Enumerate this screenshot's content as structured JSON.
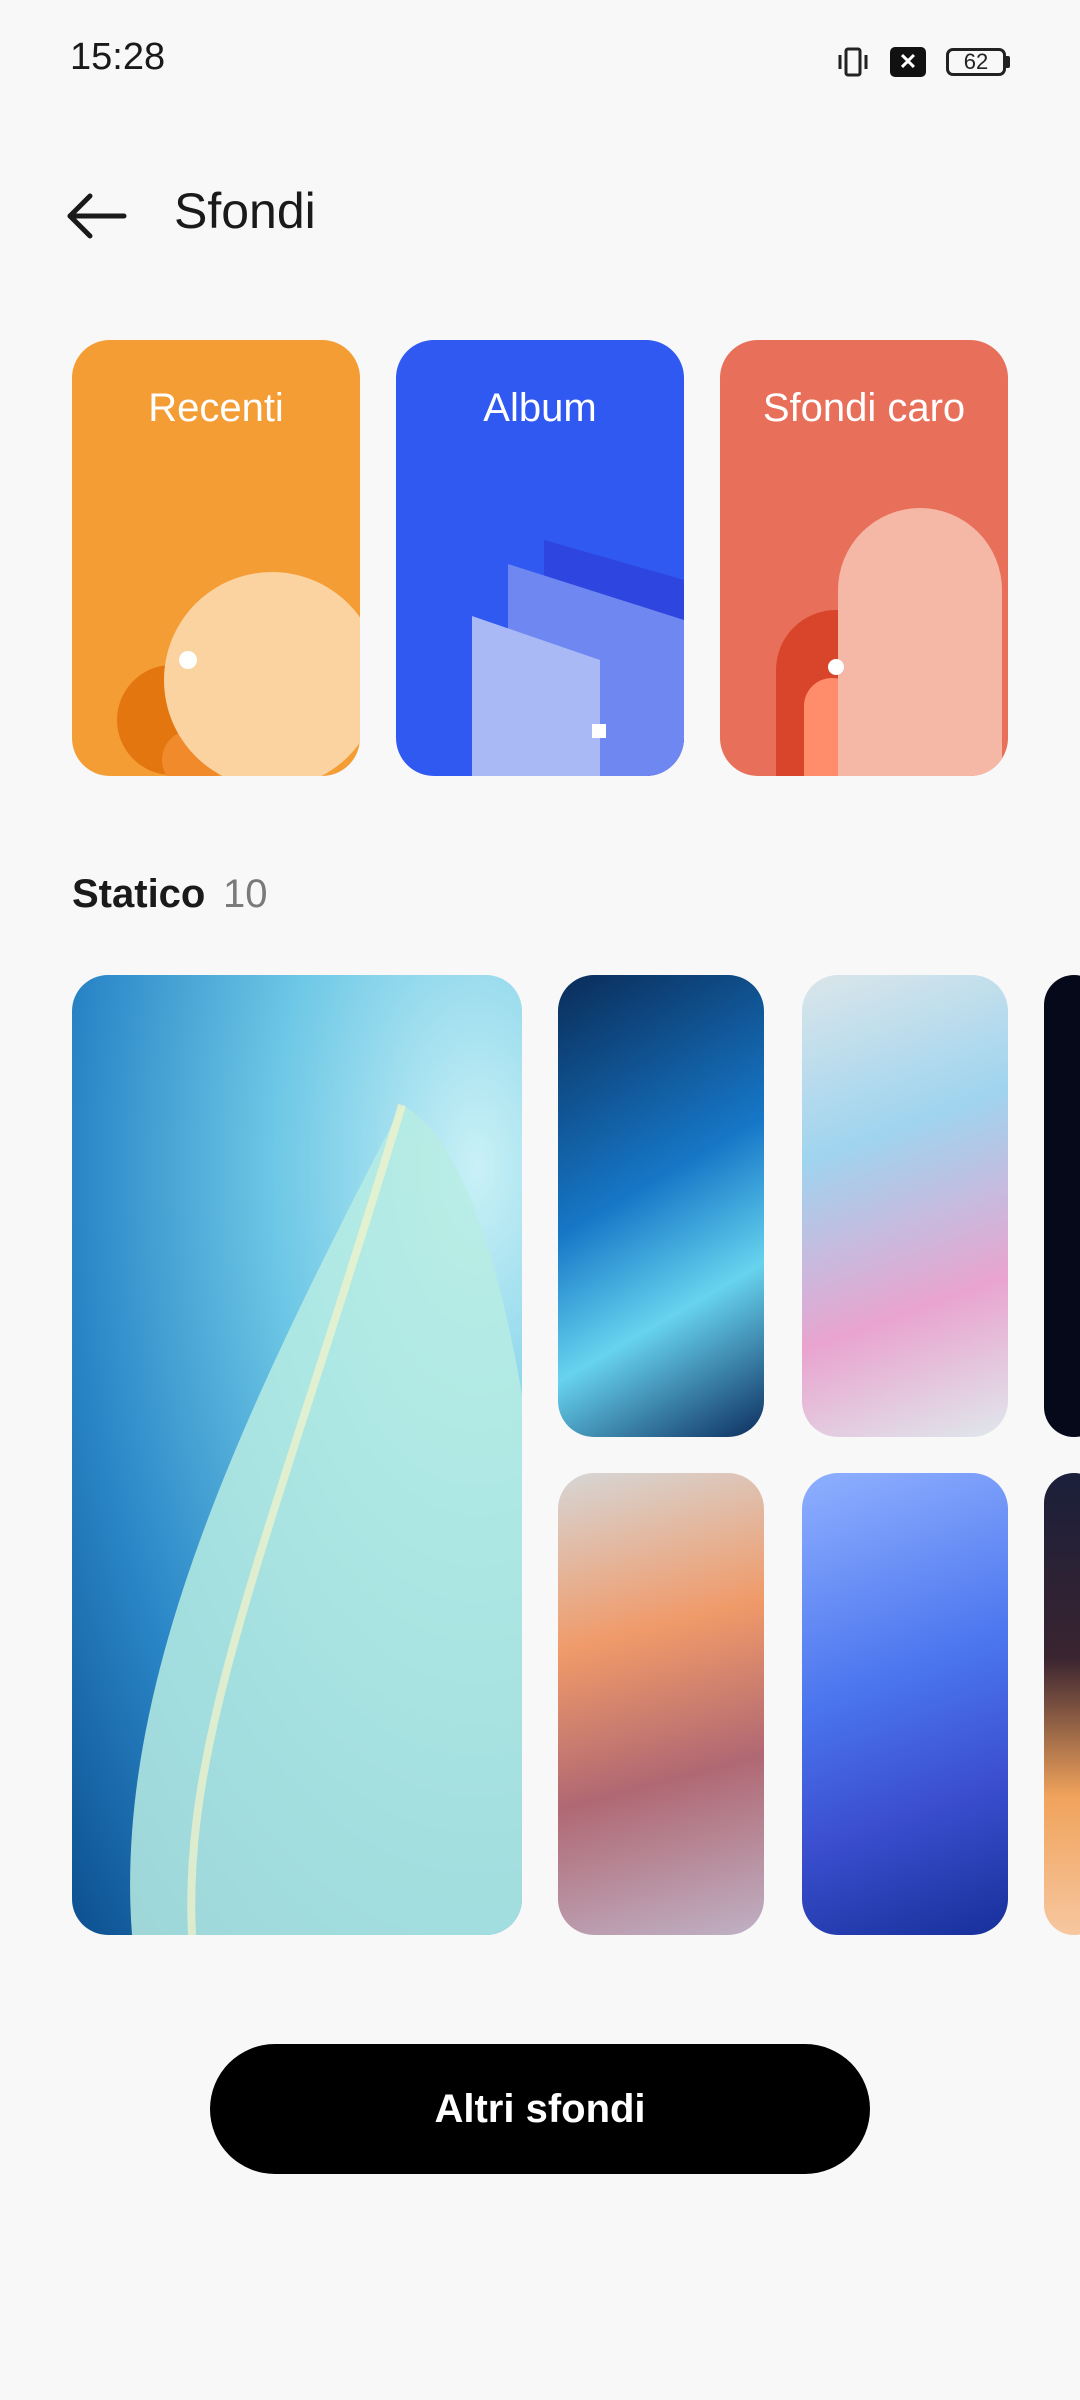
{
  "status_bar": {
    "time": "15:28",
    "battery_level": "62",
    "icons": [
      "vibrate-icon",
      "no-signal-icon",
      "battery-icon"
    ]
  },
  "header": {
    "back_icon": "arrow-left-icon",
    "title": "Sfondi"
  },
  "categories": [
    {
      "label": "Recenti",
      "color": "#f39d34"
    },
    {
      "label": "Album",
      "color": "#3059f1"
    },
    {
      "label": "Sfondi caro",
      "color": "#e8705a"
    }
  ],
  "static_section": {
    "title": "Statico",
    "count": "10"
  },
  "actions": {
    "more_label": "Altri sfondi"
  }
}
